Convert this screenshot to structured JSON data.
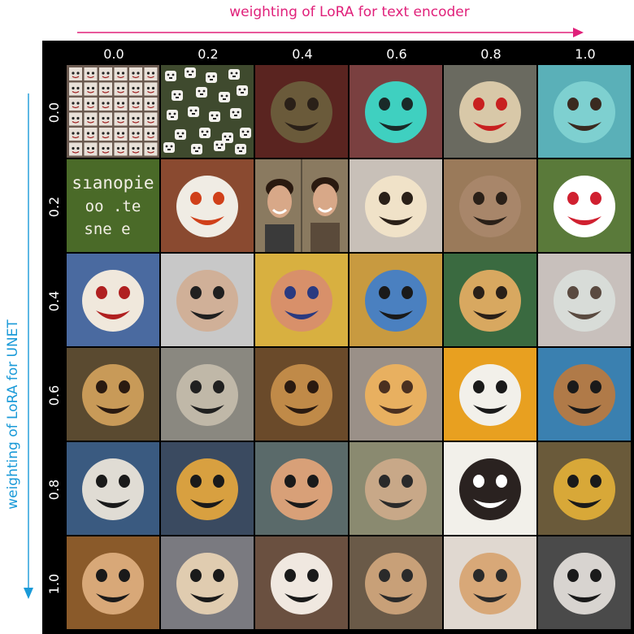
{
  "x_axis": {
    "label": "weighting of LoRA for text encoder",
    "color": "#e0207a",
    "ticks": [
      "0.0",
      "0.2",
      "0.4",
      "0.6",
      "0.8",
      "1.0"
    ]
  },
  "y_axis": {
    "label": "weighting of LoRA for UNET",
    "color": "#1a9ad8",
    "ticks": [
      "0.0",
      "0.2",
      "0.4",
      "0.6",
      "0.8",
      "1.0"
    ]
  },
  "frame_color": "#000000",
  "cells": [
    [
      {
        "kind": "tiles",
        "bg": "#6b5a50",
        "face": "#e8e0d8"
      },
      {
        "kind": "scatter",
        "bg": "#3f4a2e",
        "face": "#f4f2ee"
      },
      {
        "kind": "face",
        "bg": "#5a2420",
        "face": "#6a5a3a",
        "feat": "#2a2018"
      },
      {
        "kind": "face",
        "bg": "#7a4040",
        "face": "#3fd0c0",
        "feat": "#1a2a28"
      },
      {
        "kind": "face",
        "bg": "#6a6a60",
        "face": "#d8c8a8",
        "feat": "#c82020"
      },
      {
        "kind": "face",
        "bg": "#5ab0b8",
        "face": "#7ed0d0",
        "feat": "#3a2a20"
      }
    ],
    [
      {
        "kind": "text",
        "bg": "#4a6a28",
        "ink": "#f2efe6",
        "lines": [
          "sıanopie",
          "oo .te",
          "sne e"
        ]
      },
      {
        "kind": "face",
        "bg": "#8a4a30",
        "face": "#f0ece4",
        "feat": "#d0401a"
      },
      {
        "kind": "photo2",
        "bg": "#8a7a60",
        "face": "#d8a888",
        "feat": "#2a1a10"
      },
      {
        "kind": "face",
        "bg": "#c8c0b8",
        "face": "#f0e2c8",
        "feat": "#2a2018"
      },
      {
        "kind": "face",
        "bg": "#9a7a5a",
        "face": "#a8866a",
        "feat": "#2a2018"
      },
      {
        "kind": "face",
        "bg": "#5a7a3a",
        "face": "#ffffff",
        "feat": "#d02030"
      }
    ],
    [
      {
        "kind": "face",
        "bg": "#4a6aa0",
        "face": "#f0e8dc",
        "feat": "#b02020"
      },
      {
        "kind": "face",
        "bg": "#c8c8c8",
        "face": "#d0b098",
        "feat": "#202020"
      },
      {
        "kind": "face",
        "bg": "#d8b040",
        "face": "#d8906a",
        "feat": "#2a3a80"
      },
      {
        "kind": "face",
        "bg": "#c89a40",
        "face": "#4a80c0",
        "feat": "#1a1a1a"
      },
      {
        "kind": "face",
        "bg": "#3a6a40",
        "face": "#d8a860",
        "feat": "#2a2018"
      },
      {
        "kind": "face",
        "bg": "#c8c0bc",
        "face": "#d8dcd8",
        "feat": "#5a4a40"
      }
    ],
    [
      {
        "kind": "face",
        "bg": "#5a4a30",
        "face": "#c89a58",
        "feat": "#2a1a10"
      },
      {
        "kind": "face",
        "bg": "#8a8880",
        "face": "#c0b8a8",
        "feat": "#202020"
      },
      {
        "kind": "face",
        "bg": "#6a4a2a",
        "face": "#c08a48",
        "feat": "#2a1a10"
      },
      {
        "kind": "face",
        "bg": "#9a9088",
        "face": "#e8b060",
        "feat": "#4a3020"
      },
      {
        "kind": "face",
        "bg": "#e8a020",
        "face": "#f2f0ea",
        "feat": "#1a1a1a"
      },
      {
        "kind": "face",
        "bg": "#3a80b0",
        "face": "#b07a48",
        "feat": "#1a1a1a"
      }
    ],
    [
      {
        "kind": "face",
        "bg": "#3a5a80",
        "face": "#e0dcd4",
        "feat": "#1a1a1a"
      },
      {
        "kind": "face",
        "bg": "#3a4a60",
        "face": "#d8a040",
        "feat": "#1a1a1a"
      },
      {
        "kind": "face",
        "bg": "#5a6a6a",
        "face": "#d8a078",
        "feat": "#1a1a1a"
      },
      {
        "kind": "face",
        "bg": "#8a8a70",
        "face": "#c8a888",
        "feat": "#2a2a2a"
      },
      {
        "kind": "face",
        "bg": "#f2f0ea",
        "face": "#2a2220",
        "feat": "#ffffff"
      },
      {
        "kind": "face",
        "bg": "#6a5a3a",
        "face": "#d8a838",
        "feat": "#1a1a1a"
      }
    ],
    [
      {
        "kind": "face",
        "bg": "#8a5a2a",
        "face": "#d8a878",
        "feat": "#1a1a1a"
      },
      {
        "kind": "face",
        "bg": "#7a7a80",
        "face": "#e0ccb0",
        "feat": "#1a1a1a"
      },
      {
        "kind": "face",
        "bg": "#6a5040",
        "face": "#f0e8e0",
        "feat": "#1a1a1a"
      },
      {
        "kind": "face",
        "bg": "#6a5a48",
        "face": "#c8a078",
        "feat": "#2a2a2a"
      },
      {
        "kind": "face",
        "bg": "#e0d8d0",
        "face": "#d8a878",
        "feat": "#2a2a2a"
      },
      {
        "kind": "face",
        "bg": "#4a4a4a",
        "face": "#d8d4d0",
        "feat": "#1a1a1a"
      }
    ]
  ]
}
